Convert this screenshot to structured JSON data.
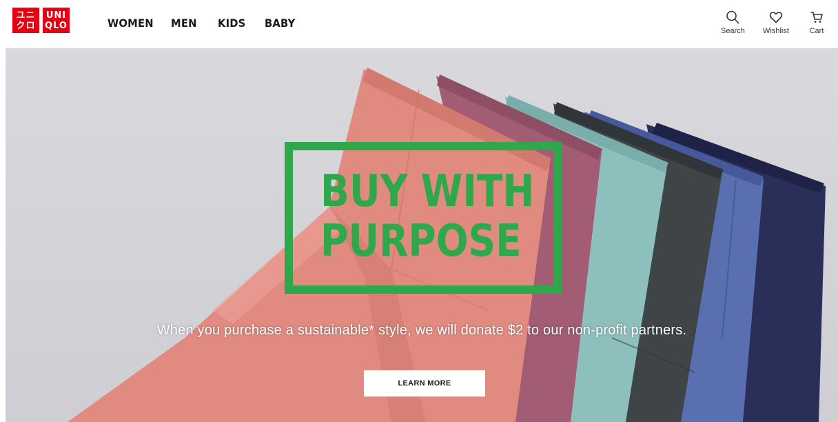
{
  "header": {
    "logo": {
      "box1": [
        "ユニ",
        "クロ"
      ],
      "box2": [
        "UNI",
        "QLO"
      ],
      "brand_color": "#e60012"
    },
    "nav": [
      "WOMEN",
      "MEN",
      "KIDS",
      "BABY"
    ],
    "utilities": [
      {
        "icon": "search-icon",
        "label": "Search"
      },
      {
        "icon": "heart-icon",
        "label": "Wishlist"
      },
      {
        "icon": "cart-icon",
        "label": "Cart"
      }
    ]
  },
  "hero": {
    "headline_line1": "BUY WITH",
    "headline_line2": "PURPOSE",
    "headline_color": "#2ea84a",
    "subtext": "When you purchase a sustainable* style, we will donate $2 to our non-profit partners.",
    "cta_label": "LEARN MORE"
  }
}
